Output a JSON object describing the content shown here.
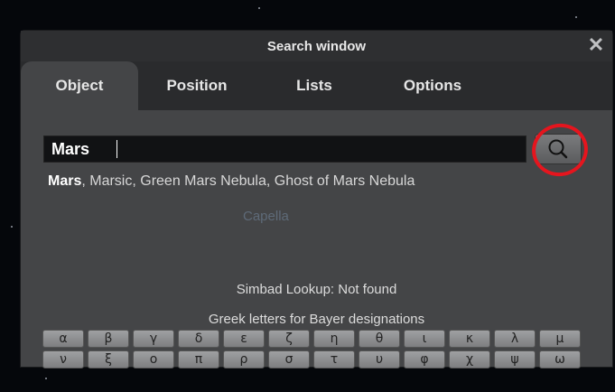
{
  "window": {
    "title": "Search window",
    "close_label": "✕"
  },
  "tabs": [
    "Object",
    "Position",
    "Lists",
    "Options"
  ],
  "search": {
    "value": "Mars"
  },
  "matches": {
    "first": "Mars",
    "rest": ", Marsic, Green Mars Nebula, Ghost of Mars Nebula"
  },
  "background_label": "Capella",
  "simbad_status": "Simbad Lookup: Not found",
  "greek": {
    "title": "Greek letters for Bayer designations",
    "row1": [
      "α",
      "β",
      "γ",
      "δ",
      "ε",
      "ζ",
      "η",
      "θ",
      "ι",
      "κ",
      "λ",
      "μ"
    ],
    "row2": [
      "ν",
      "ξ",
      "ο",
      "π",
      "ρ",
      "σ",
      "τ",
      "υ",
      "φ",
      "χ",
      "ψ",
      "ω"
    ]
  },
  "colors": {
    "highlight": "#e5151e"
  }
}
